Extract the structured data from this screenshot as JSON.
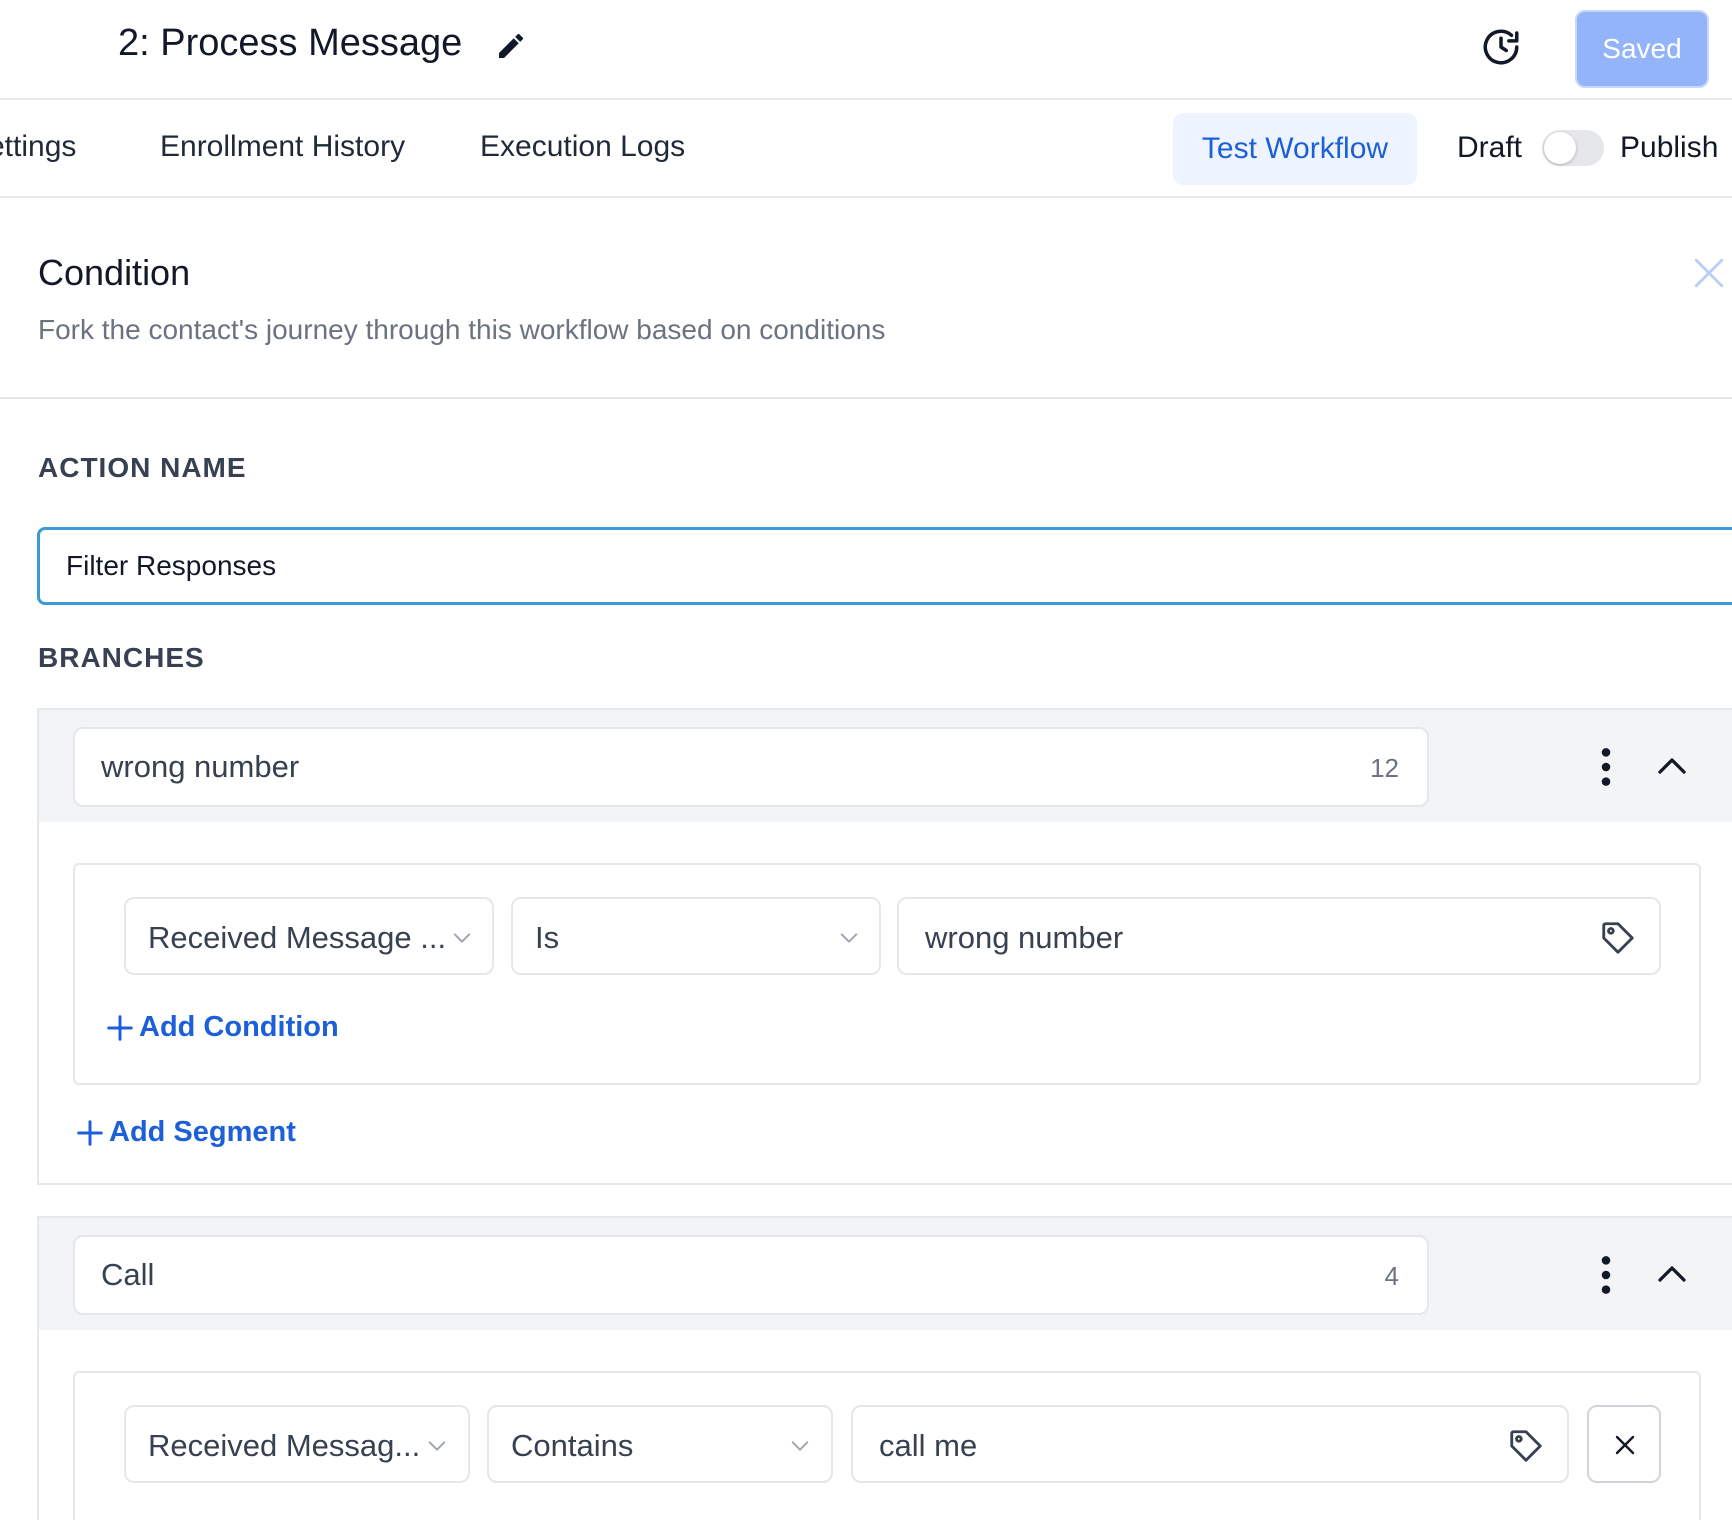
{
  "header": {
    "title": "2: Process Message",
    "edit_icon": "pencil-icon",
    "history_icon": "history-clock-icon",
    "saved_label": "Saved"
  },
  "tabs": [
    {
      "label": "ettings"
    },
    {
      "label": "Enrollment History"
    },
    {
      "label": "Execution Logs"
    }
  ],
  "toolbar": {
    "test_label": "Test Workflow",
    "draft_label": "Draft",
    "publish_label": "Publish",
    "publish_on": false
  },
  "panel": {
    "title": "Condition",
    "subtitle": "Fork the contact's journey through this workflow based on conditions"
  },
  "action_name": {
    "label": "ACTION NAME",
    "value": "Filter Responses"
  },
  "branches_label": "BRANCHES",
  "branches": [
    {
      "name": "wrong number",
      "count": "12",
      "condition": {
        "field": "Received Message ...",
        "operator": "Is",
        "value": "wrong number"
      },
      "add_condition": "Add Condition",
      "add_segment": "Add Segment"
    },
    {
      "name": "Call",
      "count": "4",
      "condition": {
        "field": "Received Messag...",
        "operator": "Contains",
        "value": "call me"
      }
    }
  ],
  "colors": {
    "accent": "#1d5fd8",
    "saved_bg": "#93b4f9",
    "focus_border": "#3b9bd6",
    "test_bg": "#eef4ff"
  }
}
